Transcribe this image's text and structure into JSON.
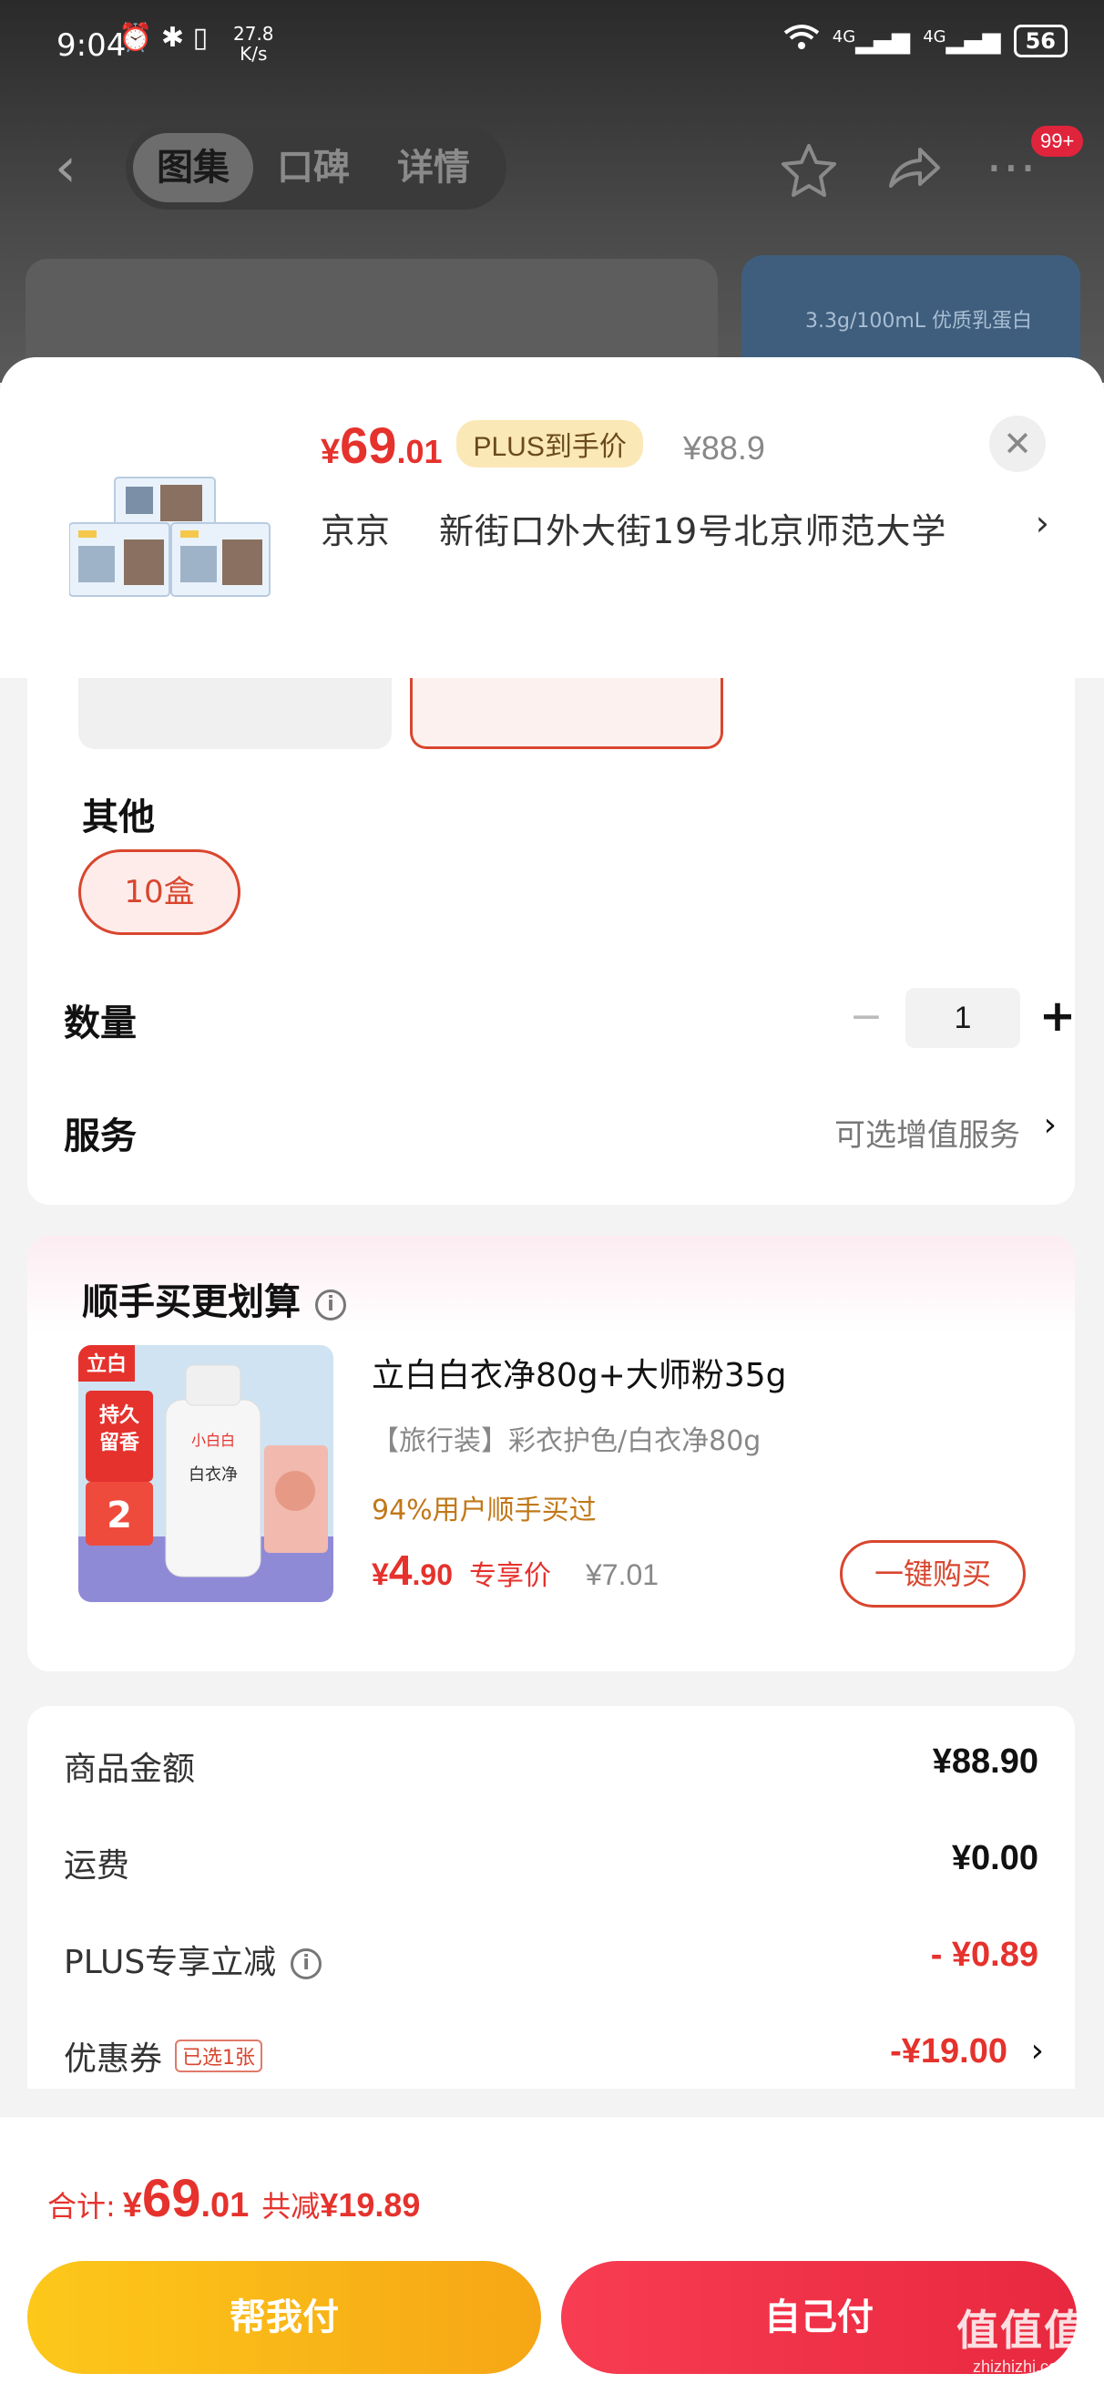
{
  "status_bar": {
    "time": "9:04",
    "net_speed": "27.8",
    "net_unit": "K/s",
    "signal1": "4G",
    "signal2": "4G",
    "battery": "56"
  },
  "nav": {
    "tabs": [
      "图集",
      "口碑",
      "详情"
    ],
    "active_tab": 0,
    "badge": "99+"
  },
  "bg_promo": "3.3g/100mL 优质乳蛋白",
  "sheet": {
    "price_yen": "¥",
    "price_int": "69",
    "price_dec": ".01",
    "plus_tag": "PLUS到手价",
    "orig_price": "¥88.9",
    "city": "京京",
    "address": "新街口外大街19号北京师范大学",
    "chevron": "›"
  },
  "specs": {
    "other_title": "其他",
    "option_selected": "10盒",
    "qty_title": "数量",
    "qty_value": "1",
    "qty_minus": "−",
    "qty_plus": "+",
    "service_title": "服务",
    "service_hint": "可选增值服务"
  },
  "bundle": {
    "title": "顺手买更划算",
    "info": "i",
    "name": "立白白衣净80g+大师粉35g",
    "sub": "【旅行装】彩衣护色/白衣净80g",
    "stat": "94%用户顺手买过",
    "price_yen": "¥",
    "price_int": "4",
    "price_dec": ".90",
    "price_tag": "专享价",
    "orig_price": "¥7.01",
    "buy_label": "一键购买",
    "img_brand": "立白",
    "img_badge1": "持久",
    "img_badge2": "留香",
    "img_badge3": "2",
    "img_bottle": "白衣净",
    "img_bottle_brand": "小白白"
  },
  "summary": {
    "rows": [
      {
        "label": "商品金额",
        "value": "¥88.90"
      },
      {
        "label": "运费",
        "value": "¥0.00"
      },
      {
        "label": "PLUS专享立减",
        "value": "- ¥0.89"
      },
      {
        "label": "优惠券",
        "value": "-¥19.00"
      }
    ],
    "coupon_tag": "已选1张"
  },
  "footer": {
    "total_label": "合计:",
    "total_yen": "¥",
    "total_int": "69",
    "total_dec": ".01",
    "save_label": "共减",
    "save_value": "¥19.89",
    "help_pay": "帮我付",
    "self_pay": "自己付",
    "watermark_logo": "值值值",
    "watermark_url": "zhizhizhi.com"
  },
  "colors": {
    "accent_red": "#e5322d",
    "plus_tag_bg": "#fbe8b7",
    "help_btn": "#fdc81a",
    "self_btn": "#f83c52"
  }
}
